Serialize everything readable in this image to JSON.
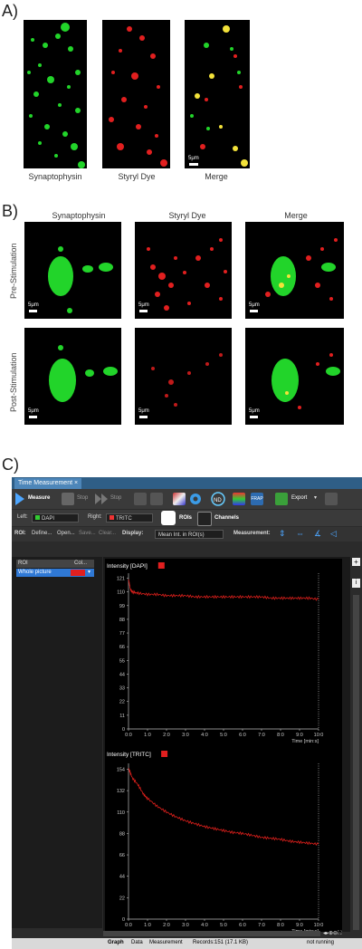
{
  "panels": {
    "a_label": "A)",
    "b_label": "B)",
    "c_label": "C)"
  },
  "panel_a": {
    "captions": [
      "Synaptophysin",
      "Styryl Dye",
      "Merge"
    ],
    "scale": "5μm"
  },
  "panel_b": {
    "headers": [
      "Synaptophysin",
      "Styryl Dye",
      "Merge"
    ],
    "rows": [
      "Pre-Stimulation",
      "Post-Stimulation"
    ],
    "scale": "5μm"
  },
  "software": {
    "tab": "Time Measurement",
    "toolbar": {
      "measure": "Measure",
      "stop1": "Stop",
      "stop2": "Stop",
      "export": "Export",
      "left_label": "Left:",
      "left_value": "DAPI",
      "right_label": "Right:",
      "right_value": "TRITC",
      "rois": "ROIs",
      "channels": "Channels",
      "roi_label": "ROI:",
      "define": "Define...",
      "open": "Open...",
      "save": "Save...",
      "clear": "Clear...",
      "display_label": "Display:",
      "display_value": "Mean Int. in ROI(s)",
      "measurement_label": "Measurement:"
    },
    "roi_table": {
      "col1": "ROI",
      "col2": "Col...",
      "row": "Whole picture"
    },
    "bottom_tabs": [
      "Graph",
      "Data",
      "Measurement"
    ],
    "records": "Records:151 (17.1 KB)",
    "status": "not running"
  },
  "chart_data": [
    {
      "type": "line",
      "title": "Intensity [DAPI]",
      "xlabel": "Time [min:s]",
      "ylabel": "",
      "xticks": [
        "0:0",
        "1:0",
        "2:0",
        "3:0",
        "4:0",
        "5:0",
        "6:0",
        "7:0",
        "8:0",
        "9:0",
        "10:0"
      ],
      "yticks": [
        0,
        11,
        22,
        33,
        44,
        55,
        66,
        77,
        88,
        99,
        110,
        121
      ],
      "ylim": [
        0,
        125
      ],
      "xlim": [
        0,
        10
      ],
      "series": [
        {
          "color": "#e0201c",
          "x": [
            0,
            0.1,
            0.2,
            0.5,
            1,
            1.5,
            2,
            2.5,
            3,
            3.5,
            4,
            4.5,
            5,
            5.5,
            6,
            6.5,
            7,
            7.5,
            8,
            8.5,
            9,
            9.5,
            10
          ],
          "y": [
            120,
            112,
            110,
            109,
            108,
            108,
            107,
            107,
            107,
            106,
            106,
            106,
            106,
            106,
            106,
            106,
            106,
            105,
            105,
            105,
            105,
            105,
            104
          ]
        }
      ]
    },
    {
      "type": "line",
      "title": "Intensity [TRITC]",
      "xlabel": "Time [min:s]",
      "ylabel": "",
      "xticks": [
        "0:0",
        "1:0",
        "2:0",
        "3:0",
        "4:0",
        "5:0",
        "6:0",
        "7:0",
        "8:0",
        "9:0",
        "10:0"
      ],
      "yticks": [
        0,
        22,
        44,
        66,
        88,
        110,
        132,
        154
      ],
      "ylim": [
        0,
        160
      ],
      "xlim": [
        0,
        10
      ],
      "series": [
        {
          "color": "#e0201c",
          "x": [
            0,
            0.2,
            0.5,
            0.8,
            1,
            1.5,
            2,
            2.5,
            3,
            3.5,
            4,
            4.5,
            5,
            5.5,
            6,
            6.5,
            7,
            7.5,
            8,
            8.5,
            9,
            9.5,
            10
          ],
          "y": [
            155,
            145,
            138,
            128,
            124,
            116,
            110,
            105,
            101,
            98,
            95,
            93,
            91,
            89,
            88,
            86,
            84,
            83,
            82,
            80,
            79,
            78,
            77
          ]
        }
      ]
    }
  ],
  "colors": {
    "green": "#22d42a",
    "red": "#e11f1f",
    "yellow": "#f3e23a",
    "window_bg": "#2b2b2b",
    "tab_blue": "#4d86b9",
    "roi_highlight": "#2f78d4"
  }
}
